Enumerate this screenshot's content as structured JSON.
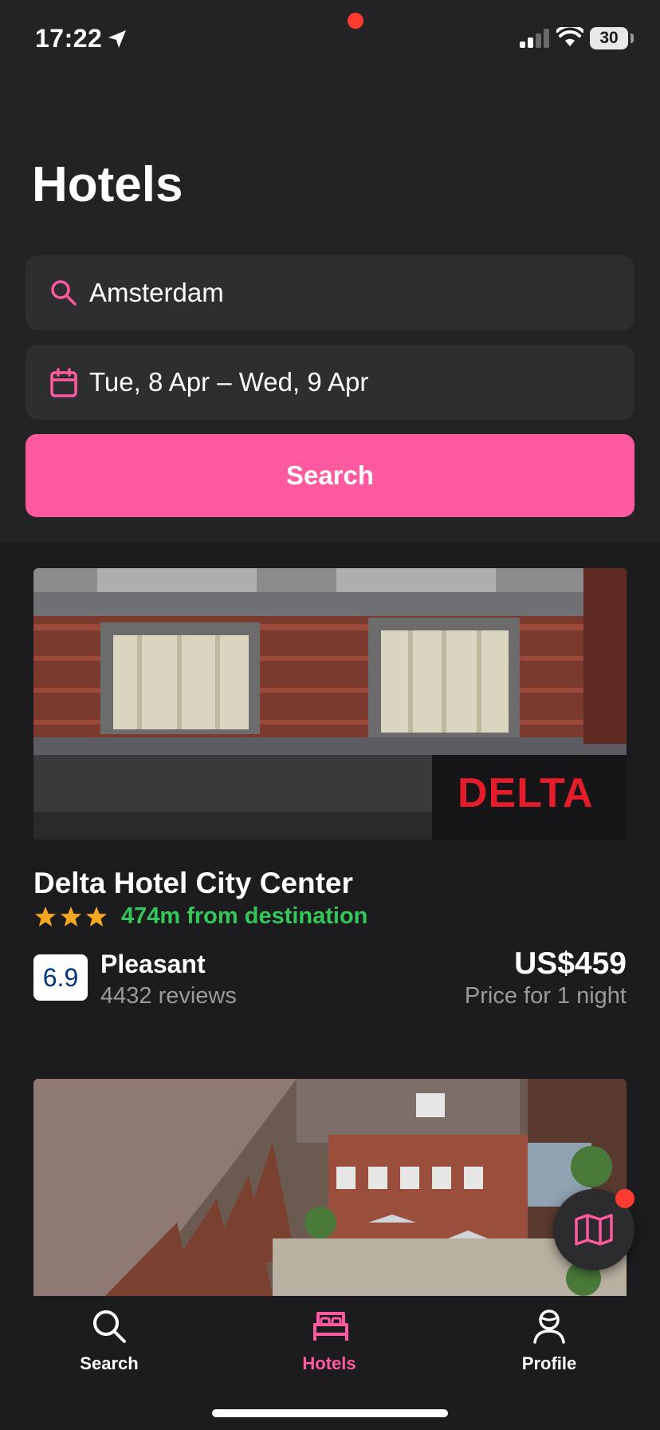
{
  "status_bar": {
    "time": "17:22",
    "battery": "30"
  },
  "page": {
    "title": "Hotels"
  },
  "search_form": {
    "destination": "Amsterdam",
    "dates": "Tue, 8 Apr – Wed, 9 Apr",
    "button_label": "Search"
  },
  "hotels": [
    {
      "image_sign_text": "DELTA",
      "name": "Delta Hotel City Center",
      "stars": 3,
      "distance": "474m from destination",
      "score": "6.9",
      "score_word": "Pleasant",
      "reviews": "4432 reviews",
      "price": "US$459",
      "price_note": "Price for 1 night"
    }
  ],
  "tab_bar": {
    "items": [
      {
        "label": "Search",
        "icon": "search-icon"
      },
      {
        "label": "Hotels",
        "icon": "bed-icon",
        "active": true
      },
      {
        "label": "Profile",
        "icon": "profile-icon"
      }
    ]
  },
  "colors": {
    "accent": "#ff5a9f",
    "green": "#34c759",
    "badge": "#ff3b30",
    "star": "#f5a623"
  }
}
